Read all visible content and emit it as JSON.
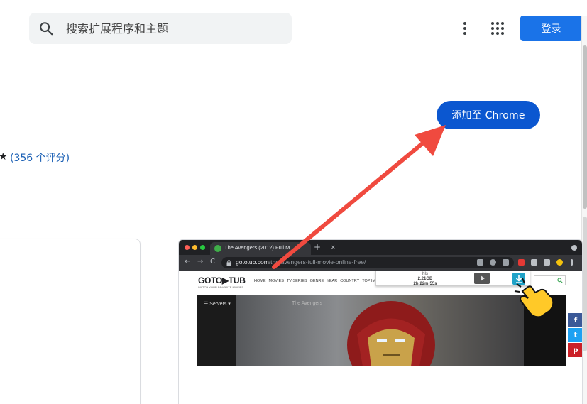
{
  "header": {
    "search_placeholder": "搜索扩展程序和主题",
    "login_label": "登录"
  },
  "detail": {
    "add_button_label": "添加至 Chrome",
    "rating_star": "★",
    "rating_text": "(356 个评分)"
  },
  "screenshot": {
    "tab_title": "The Avengers (2012) Full M",
    "new_tab": "+",
    "nav_back": "←",
    "nav_forward": "→",
    "nav_reload": "C",
    "url_host": "gototub.com",
    "url_path": "/the-avengers-full-movie-online-free/",
    "logo": "GOTO▶TUB",
    "logo_tagline": "WATCH YOUR FAVORITE MOVIES",
    "site_nav": [
      "HOME",
      "MOVIES",
      "TV-SERIES",
      "GENRE",
      "YEAR",
      "COUNTRY",
      "TOP IMDB"
    ],
    "download": {
      "format": "hls",
      "size": "2.21GB",
      "duration": "2h:22m:55s"
    },
    "player": {
      "servers_label": "☰  Servers ▾",
      "now_playing": "The Avengers"
    },
    "social": [
      {
        "name": "facebook",
        "glyph": "f",
        "color": "#3b5998"
      },
      {
        "name": "twitter",
        "glyph": "t",
        "color": "#1da1f2"
      },
      {
        "name": "pinterest",
        "glyph": "p",
        "color": "#cb2027"
      }
    ]
  },
  "colors": {
    "login_button": "#1a73e8",
    "add_button": "#0b57d0",
    "rating_link": "#1a5fb4",
    "annotation_arrow": "#f04a3f"
  }
}
